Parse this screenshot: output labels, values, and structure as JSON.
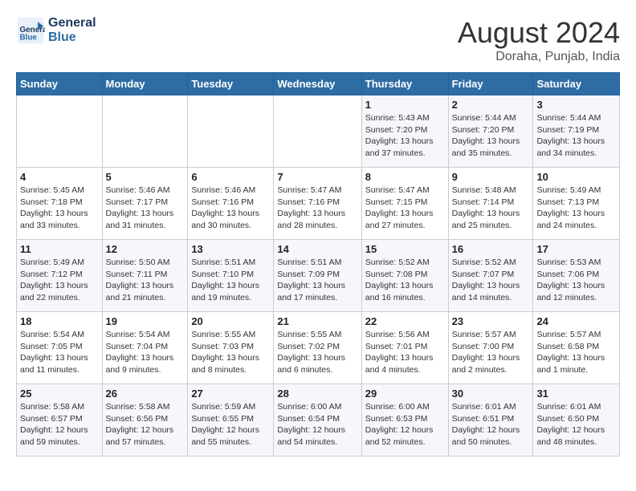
{
  "logo": {
    "line1": "General",
    "line2": "Blue"
  },
  "title": "August 2024",
  "subtitle": "Doraha, Punjab, India",
  "days_of_week": [
    "Sunday",
    "Monday",
    "Tuesday",
    "Wednesday",
    "Thursday",
    "Friday",
    "Saturday"
  ],
  "weeks": [
    [
      {
        "num": "",
        "info": ""
      },
      {
        "num": "",
        "info": ""
      },
      {
        "num": "",
        "info": ""
      },
      {
        "num": "",
        "info": ""
      },
      {
        "num": "1",
        "info": "Sunrise: 5:43 AM\nSunset: 7:20 PM\nDaylight: 13 hours\nand 37 minutes."
      },
      {
        "num": "2",
        "info": "Sunrise: 5:44 AM\nSunset: 7:20 PM\nDaylight: 13 hours\nand 35 minutes."
      },
      {
        "num": "3",
        "info": "Sunrise: 5:44 AM\nSunset: 7:19 PM\nDaylight: 13 hours\nand 34 minutes."
      }
    ],
    [
      {
        "num": "4",
        "info": "Sunrise: 5:45 AM\nSunset: 7:18 PM\nDaylight: 13 hours\nand 33 minutes."
      },
      {
        "num": "5",
        "info": "Sunrise: 5:46 AM\nSunset: 7:17 PM\nDaylight: 13 hours\nand 31 minutes."
      },
      {
        "num": "6",
        "info": "Sunrise: 5:46 AM\nSunset: 7:16 PM\nDaylight: 13 hours\nand 30 minutes."
      },
      {
        "num": "7",
        "info": "Sunrise: 5:47 AM\nSunset: 7:16 PM\nDaylight: 13 hours\nand 28 minutes."
      },
      {
        "num": "8",
        "info": "Sunrise: 5:47 AM\nSunset: 7:15 PM\nDaylight: 13 hours\nand 27 minutes."
      },
      {
        "num": "9",
        "info": "Sunrise: 5:48 AM\nSunset: 7:14 PM\nDaylight: 13 hours\nand 25 minutes."
      },
      {
        "num": "10",
        "info": "Sunrise: 5:49 AM\nSunset: 7:13 PM\nDaylight: 13 hours\nand 24 minutes."
      }
    ],
    [
      {
        "num": "11",
        "info": "Sunrise: 5:49 AM\nSunset: 7:12 PM\nDaylight: 13 hours\nand 22 minutes."
      },
      {
        "num": "12",
        "info": "Sunrise: 5:50 AM\nSunset: 7:11 PM\nDaylight: 13 hours\nand 21 minutes."
      },
      {
        "num": "13",
        "info": "Sunrise: 5:51 AM\nSunset: 7:10 PM\nDaylight: 13 hours\nand 19 minutes."
      },
      {
        "num": "14",
        "info": "Sunrise: 5:51 AM\nSunset: 7:09 PM\nDaylight: 13 hours\nand 17 minutes."
      },
      {
        "num": "15",
        "info": "Sunrise: 5:52 AM\nSunset: 7:08 PM\nDaylight: 13 hours\nand 16 minutes."
      },
      {
        "num": "16",
        "info": "Sunrise: 5:52 AM\nSunset: 7:07 PM\nDaylight: 13 hours\nand 14 minutes."
      },
      {
        "num": "17",
        "info": "Sunrise: 5:53 AM\nSunset: 7:06 PM\nDaylight: 13 hours\nand 12 minutes."
      }
    ],
    [
      {
        "num": "18",
        "info": "Sunrise: 5:54 AM\nSunset: 7:05 PM\nDaylight: 13 hours\nand 11 minutes."
      },
      {
        "num": "19",
        "info": "Sunrise: 5:54 AM\nSunset: 7:04 PM\nDaylight: 13 hours\nand 9 minutes."
      },
      {
        "num": "20",
        "info": "Sunrise: 5:55 AM\nSunset: 7:03 PM\nDaylight: 13 hours\nand 8 minutes."
      },
      {
        "num": "21",
        "info": "Sunrise: 5:55 AM\nSunset: 7:02 PM\nDaylight: 13 hours\nand 6 minutes."
      },
      {
        "num": "22",
        "info": "Sunrise: 5:56 AM\nSunset: 7:01 PM\nDaylight: 13 hours\nand 4 minutes."
      },
      {
        "num": "23",
        "info": "Sunrise: 5:57 AM\nSunset: 7:00 PM\nDaylight: 13 hours\nand 2 minutes."
      },
      {
        "num": "24",
        "info": "Sunrise: 5:57 AM\nSunset: 6:58 PM\nDaylight: 13 hours\nand 1 minute."
      }
    ],
    [
      {
        "num": "25",
        "info": "Sunrise: 5:58 AM\nSunset: 6:57 PM\nDaylight: 12 hours\nand 59 minutes."
      },
      {
        "num": "26",
        "info": "Sunrise: 5:58 AM\nSunset: 6:56 PM\nDaylight: 12 hours\nand 57 minutes."
      },
      {
        "num": "27",
        "info": "Sunrise: 5:59 AM\nSunset: 6:55 PM\nDaylight: 12 hours\nand 55 minutes."
      },
      {
        "num": "28",
        "info": "Sunrise: 6:00 AM\nSunset: 6:54 PM\nDaylight: 12 hours\nand 54 minutes."
      },
      {
        "num": "29",
        "info": "Sunrise: 6:00 AM\nSunset: 6:53 PM\nDaylight: 12 hours\nand 52 minutes."
      },
      {
        "num": "30",
        "info": "Sunrise: 6:01 AM\nSunset: 6:51 PM\nDaylight: 12 hours\nand 50 minutes."
      },
      {
        "num": "31",
        "info": "Sunrise: 6:01 AM\nSunset: 6:50 PM\nDaylight: 12 hours\nand 48 minutes."
      }
    ]
  ]
}
